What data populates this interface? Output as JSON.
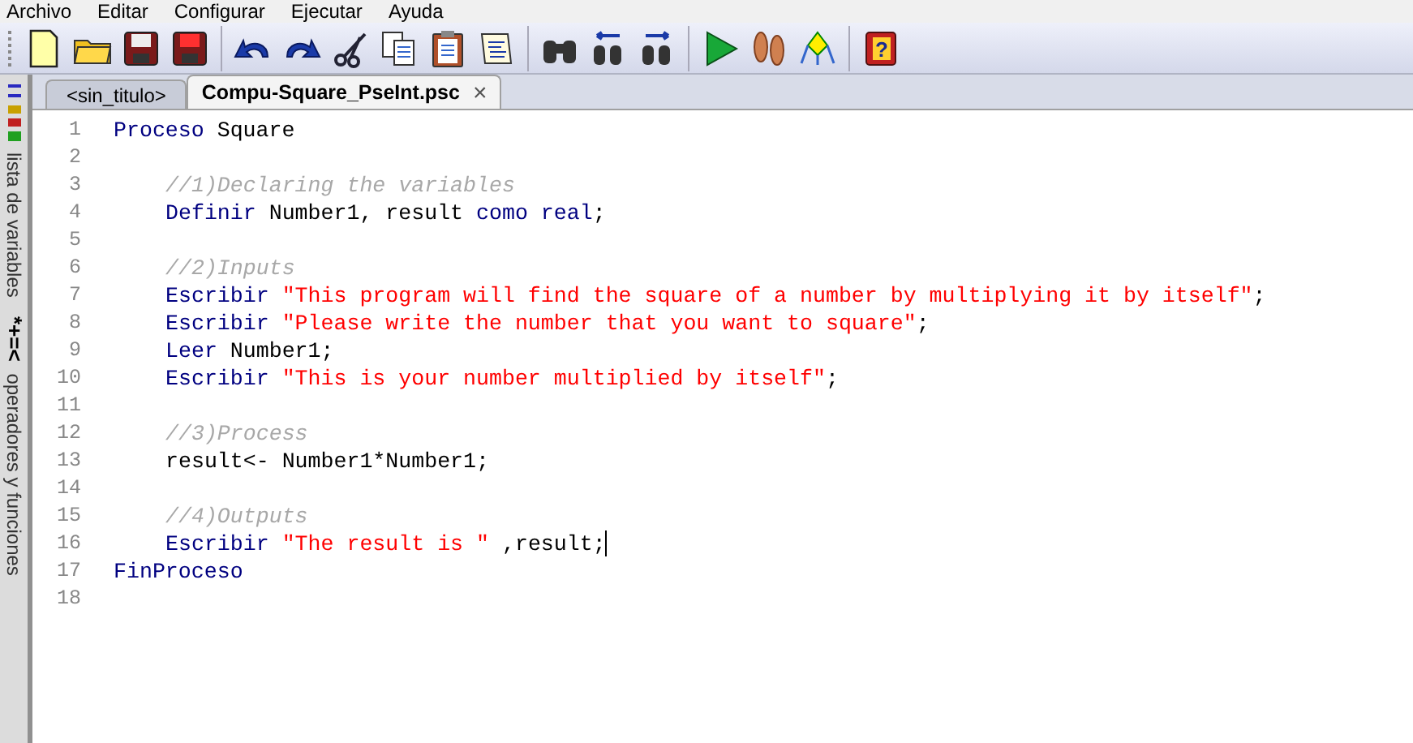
{
  "menu": [
    "Archivo",
    "Editar",
    "Configurar",
    "Ejecutar",
    "Ayuda"
  ],
  "help_glyph": "?",
  "side_panel": [
    {
      "kind": "variables",
      "label": "lista de variables"
    },
    {
      "kind": "operators",
      "symbols": "*+=<",
      "label": "operadores y funciones"
    }
  ],
  "tabs": [
    {
      "label": "<sin_titulo>",
      "selected": false,
      "closable": false
    },
    {
      "label": "Compu-Square_PseInt.psc",
      "selected": true,
      "closable": true
    }
  ],
  "close_glyph": "×",
  "lines": [
    {
      "number": "1",
      "cursor": false,
      "indented": false,
      "segments": [
        {
          "kind": "keyword",
          "text": "Proceso "
        },
        {
          "kind": "plain",
          "text": "Square"
        }
      ]
    },
    {
      "number": "2",
      "cursor": false
    },
    {
      "number": "3",
      "cursor": false,
      "indented": true,
      "segments": [
        {
          "kind": "comment",
          "text": "//1)Declaring the variables"
        }
      ]
    },
    {
      "number": "4",
      "cursor": false,
      "indented": true,
      "segments": [
        {
          "kind": "keyword",
          "text": "Definir "
        },
        {
          "kind": "plain",
          "text": "Number1, result "
        },
        {
          "kind": "keyword",
          "text": "como real"
        },
        {
          "kind": "plain",
          "text": ";"
        }
      ]
    },
    {
      "number": "5",
      "cursor": false
    },
    {
      "number": "6",
      "cursor": false,
      "indented": true,
      "segments": [
        {
          "kind": "comment",
          "text": "//2)Inputs"
        }
      ]
    },
    {
      "number": "7",
      "cursor": false,
      "indented": true,
      "segments": [
        {
          "kind": "keyword",
          "text": "Escribir "
        },
        {
          "kind": "string",
          "text": "\"This program will find the square of a number by multiplying it by itself\""
        },
        {
          "kind": "plain",
          "text": ";"
        }
      ]
    },
    {
      "number": "8",
      "cursor": false,
      "indented": true,
      "segments": [
        {
          "kind": "keyword",
          "text": "Escribir "
        },
        {
          "kind": "string",
          "text": "\"Please write the number that you want to square\""
        },
        {
          "kind": "plain",
          "text": ";"
        }
      ]
    },
    {
      "number": "9",
      "cursor": false,
      "indented": true,
      "segments": [
        {
          "kind": "keyword",
          "text": "Leer "
        },
        {
          "kind": "plain",
          "text": "Number1;"
        }
      ]
    },
    {
      "number": "10",
      "cursor": false,
      "indented": true,
      "segments": [
        {
          "kind": "keyword",
          "text": "Escribir "
        },
        {
          "kind": "string",
          "text": "\"This is your number multiplied by itself\""
        },
        {
          "kind": "plain",
          "text": ";"
        }
      ]
    },
    {
      "number": "11",
      "cursor": false
    },
    {
      "number": "12",
      "cursor": false,
      "indented": true,
      "segments": [
        {
          "kind": "comment",
          "text": "//3)Process"
        }
      ]
    },
    {
      "number": "13",
      "cursor": false,
      "indented": true,
      "segments": [
        {
          "kind": "plain",
          "text": "result<- Number1*Number1;"
        }
      ]
    },
    {
      "number": "14",
      "cursor": false
    },
    {
      "number": "15",
      "cursor": false,
      "indented": true,
      "segments": [
        {
          "kind": "comment",
          "text": "//4)Outputs"
        }
      ]
    },
    {
      "number": "16",
      "cursor": true,
      "indented": true,
      "segments": [
        {
          "kind": "keyword",
          "text": "Escribir "
        },
        {
          "kind": "string",
          "text": "\"The result is \""
        },
        {
          "kind": "plain",
          "text": " ,result;"
        }
      ]
    },
    {
      "number": "17",
      "cursor": false,
      "indented": false,
      "segments": [
        {
          "kind": "keyword",
          "text": "FinProceso"
        }
      ]
    },
    {
      "number": "18",
      "cursor": false
    }
  ]
}
